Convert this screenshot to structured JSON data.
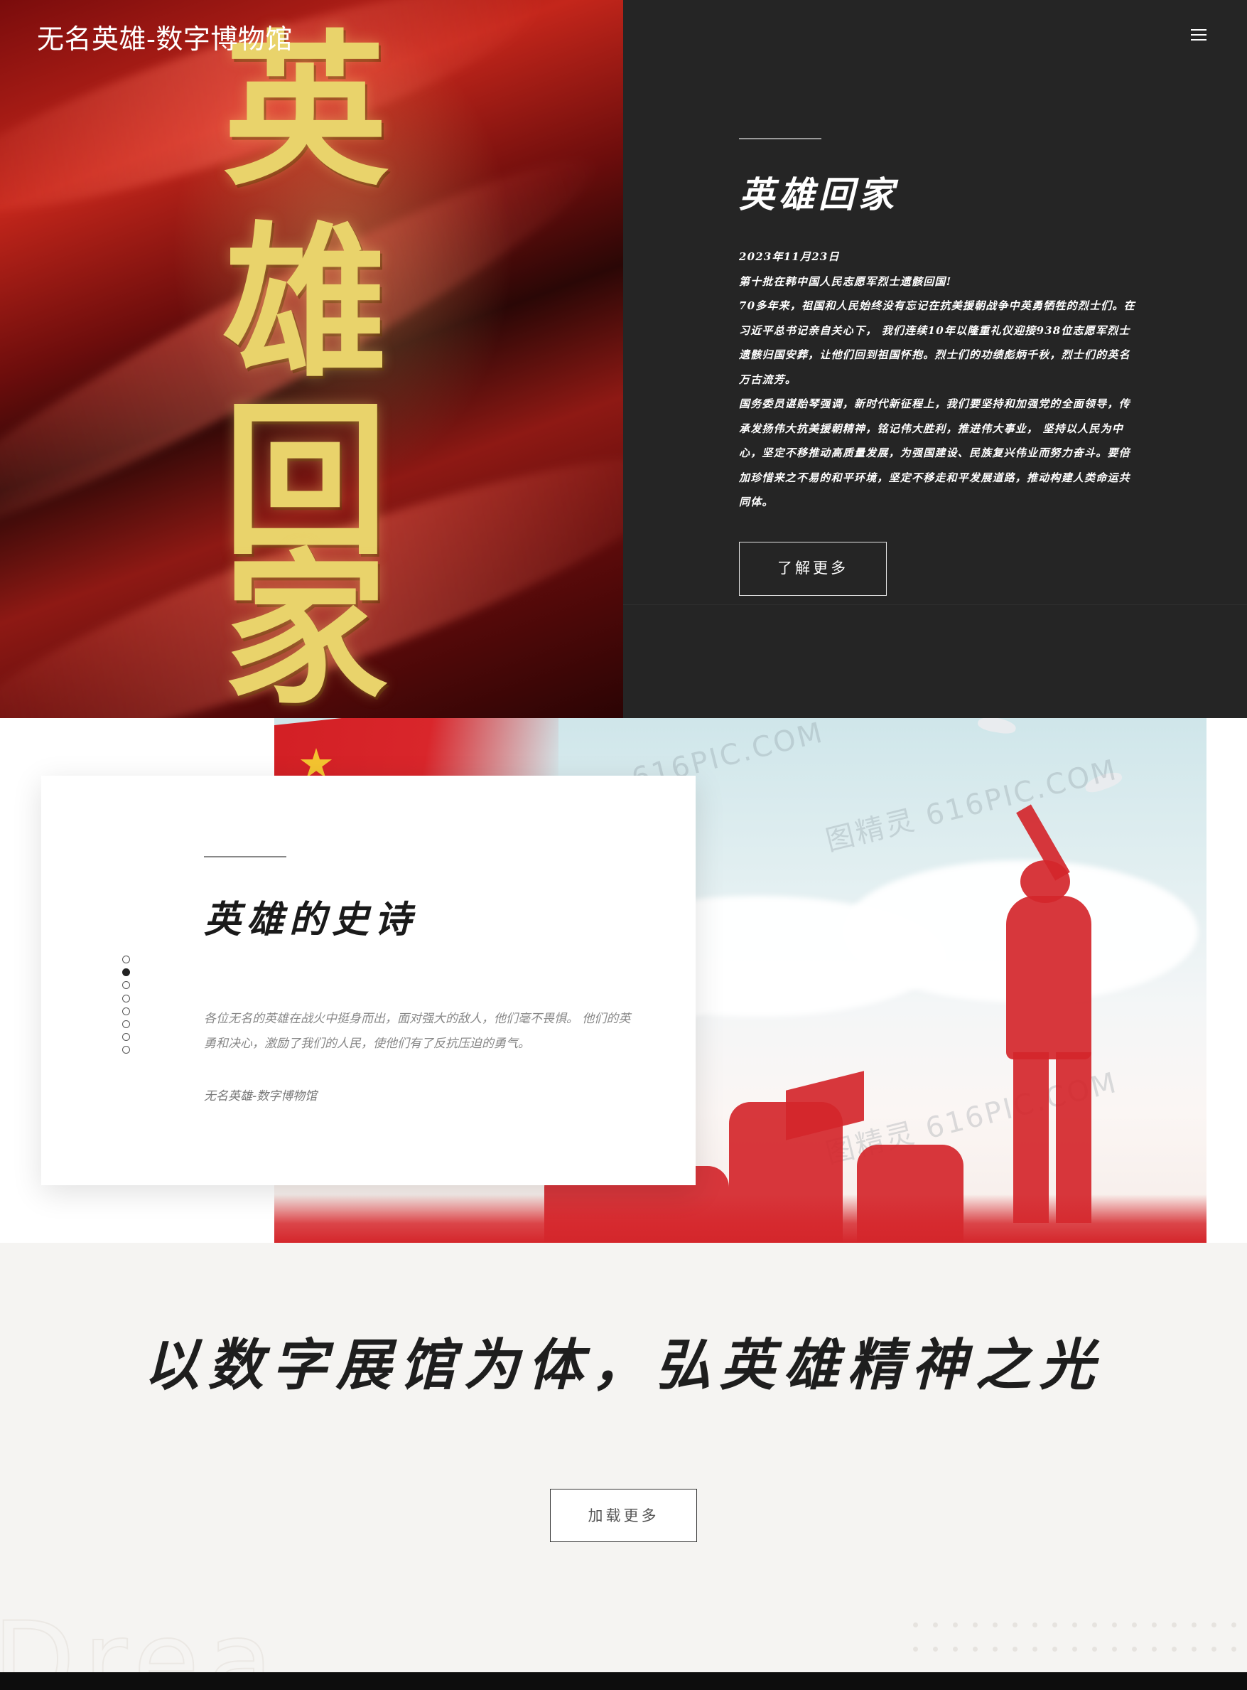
{
  "header": {
    "site_title": "无名英雄-数字博物馆",
    "menu_icon": "hamburger-menu-icon"
  },
  "hero": {
    "poster_calligraphy": [
      "英",
      "雄",
      "回",
      "家"
    ],
    "heading": "英雄回家",
    "paragraphs": [
      "2023年11月23日",
      "第十批在韩中国人民志愿军烈士遗骸回国!",
      "70多年来，祖国和人民始终没有忘记在抗美援朝战争中英勇牺牲的烈士们。在习近平总书记亲自关心下， 我们连续10年以隆重礼仪迎接938位志愿军烈士遗骸归国安葬，让他们回到祖国怀抱。烈士们的功绩彪炳千秋，烈士们的英名万古流芳。",
      "国务委员谌贻琴强调，新时代新征程上，我们要坚持和加强党的全面领导，传承发扬伟大抗美援朝精神，铭记伟大胜利，推进伟大事业， 坚持以人民为中心，坚定不移推动高质量发展，为强国建设、民族复兴伟业而努力奋斗。要倍加珍惜来之不易的和平环境，坚定不移走和平发展道路，推动构建人类命运共同体。"
    ],
    "button_label": "了解更多"
  },
  "epic": {
    "heading": "英雄的史诗",
    "body": "各位无名的英雄在战火中挺身而出，面对强大的敌人，他们毫不畏惧。 他们的英勇和决心，激励了我们的人民，使他们有了反抗压迫的勇气。",
    "signature": "无名英雄-数字博物馆",
    "slide_count": 8,
    "active_slide": 2,
    "watermarks": [
      "图精灵 616PIC.COM",
      "616PIC.COM",
      "图精灵 616PIC.COM"
    ]
  },
  "slogan": {
    "text": "以数字展馆为体，弘英雄精神之光",
    "button_label": "加载更多"
  },
  "colors": {
    "hero_panel": "#252525",
    "accent_red": "#d4262b",
    "gold": "#e9d36b",
    "page_bg": "#f5f4f2"
  }
}
